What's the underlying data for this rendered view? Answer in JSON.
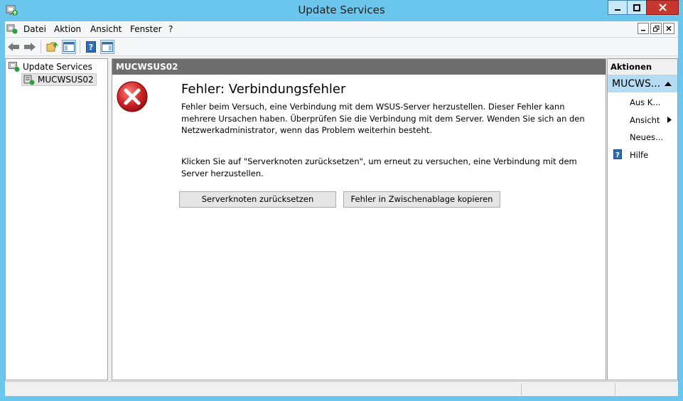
{
  "window": {
    "title": "Update Services"
  },
  "menu": {
    "items": [
      "Datei",
      "Aktion",
      "Ansicht",
      "Fenster",
      "?"
    ]
  },
  "tree": {
    "root": "Update Services",
    "child": "MUCWSUS02"
  },
  "main": {
    "header": "MUCWSUS02",
    "error_title": "Fehler: Verbindungsfehler",
    "error_text": "Fehler beim Versuch, eine Verbindung mit dem WSUS-Server herzustellen. Dieser Fehler kann mehrere Ursachen haben. Überprüfen Sie die Verbindung mit dem Server. Wenden Sie sich an den Netzwerkadministrator, wenn das Problem weiterhin besteht.",
    "reset_hint": "Klicken Sie auf \"Serverknoten zurücksetzen\", um erneut zu versuchen, eine Verbindung mit dem Server herzustellen.",
    "reset_button": "Serverknoten zurücksetzen",
    "copy_button": "Fehler in Zwischenablage kopieren"
  },
  "actions": {
    "header": "Aktionen",
    "section": "MUCWS...",
    "items": [
      "Aus K...",
      "Ansicht",
      "Neues...",
      "Hilfe"
    ]
  },
  "colors": {
    "titlebar": "#6bc6ee",
    "close": "#c7372f",
    "header_bar": "#6e6e6e",
    "section": "#b5dcf3",
    "error_red": "#c4161c"
  }
}
